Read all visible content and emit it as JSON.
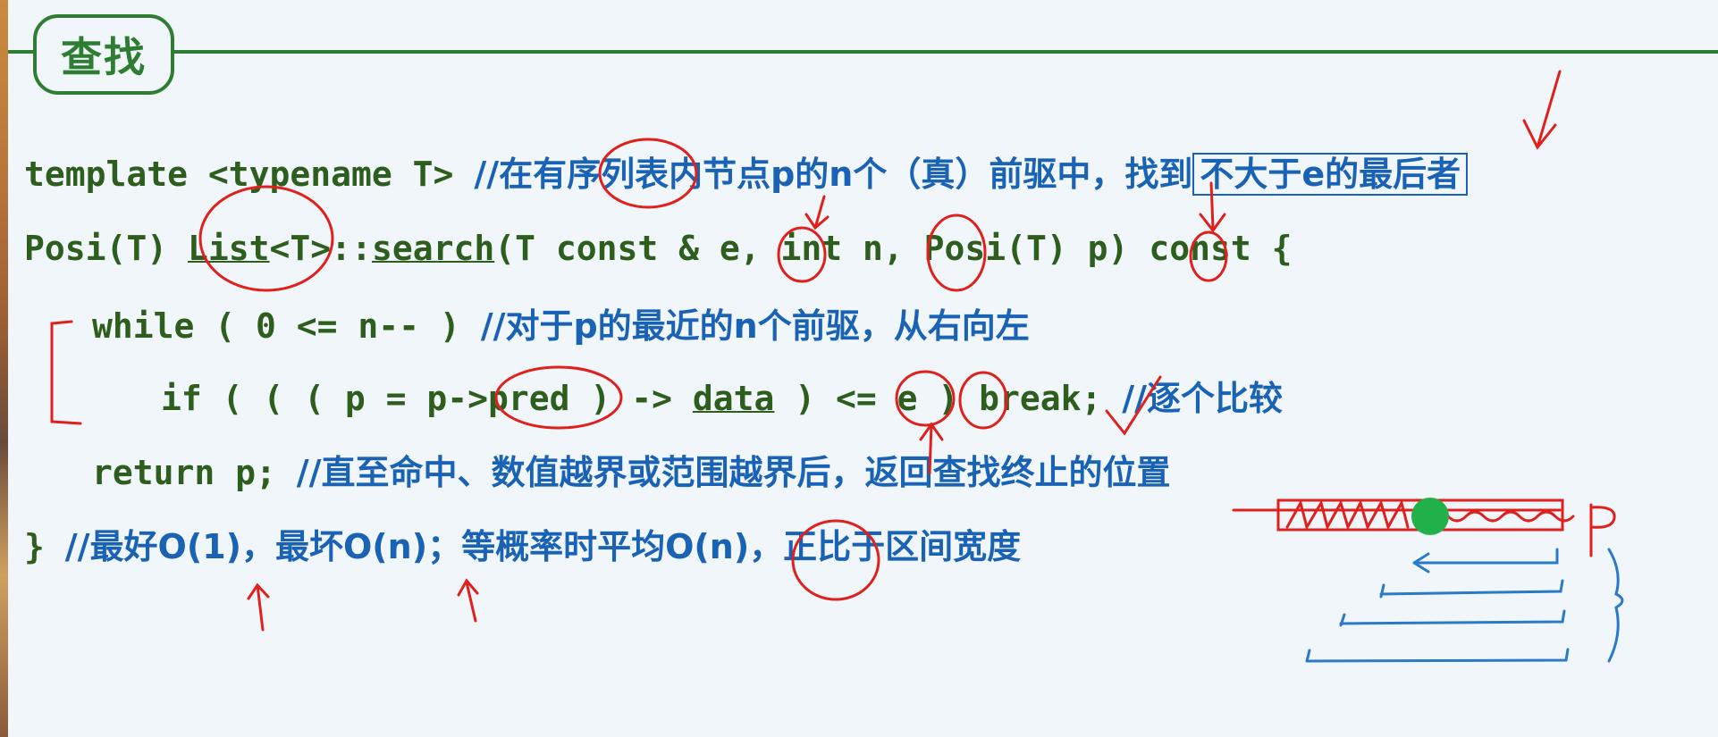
{
  "slide": {
    "title": "查找",
    "line1": {
      "code": "template <typename T> ",
      "comment": "//在有序列表内节点p的n个（真）前驱中，找到",
      "boxed": "不大于e的最后者"
    },
    "line2": {
      "a": "Posi(T) ",
      "list": "List",
      "b": "<T>::",
      "search": "search",
      "c": "(T const & e, int n, Posi(T) p) const {"
    },
    "line3": {
      "code": "while ( 0 <= n-- ) ",
      "comment": "//对于p的最近的n个前驱，从右向左"
    },
    "line4": {
      "a": "if ( ( ( p = p->pred ) -> ",
      "data": "data",
      "b": " ) <= e ) break; ",
      "comment": "//逐个比较"
    },
    "line5": {
      "code": "return p; ",
      "comment": "//直至命中、数值越界或范围越界后，返回查找终止的位置"
    },
    "line6": {
      "code": "} ",
      "comment": "//最好O(1)，最坏O(n)；等概率时平均O(n)，正比于区间宽度"
    },
    "annotation": {
      "p_label": "p"
    }
  },
  "colors": {
    "code": "#2e5e1e",
    "comment": "#1a63b4",
    "title": "#2e7d32",
    "ink_red": "#e0201c",
    "ink_blue": "#2a7ac8",
    "ink_green": "#22b04a"
  }
}
